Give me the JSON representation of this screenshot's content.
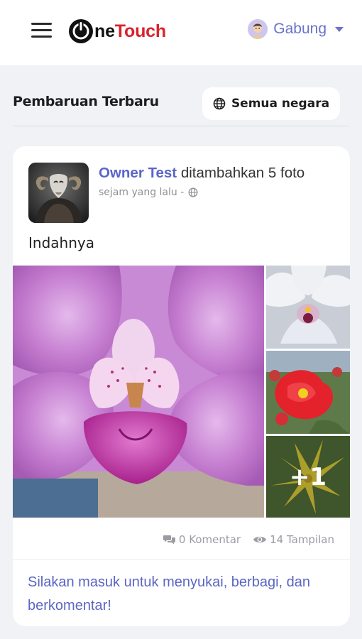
{
  "header": {
    "logo_text_prefix": "ne",
    "logo_text_brand": "Touch",
    "join_label": "Gabung",
    "brand_color": "#d9232a",
    "accent_color": "#6a73c9"
  },
  "section": {
    "title": "Pembaruan Terbaru",
    "country_filter_label": "Semua negara"
  },
  "post": {
    "author": "Owner Test",
    "action": "ditambahkan 5 foto",
    "time": "sejam yang lalu -",
    "text": "Indahnya",
    "more_photos_label": "+1",
    "comments_label": "0 Komentar",
    "views_label": "14 Tampilan",
    "login_prompt": "Silakan masuk untuk menyukai, berbagi, dan berkomentar!"
  },
  "icons": {
    "menu": "hamburger-menu-icon",
    "globe": "globe-icon",
    "comments": "comments-icon",
    "views": "eye-icon",
    "dropdown": "caret-down-icon"
  }
}
